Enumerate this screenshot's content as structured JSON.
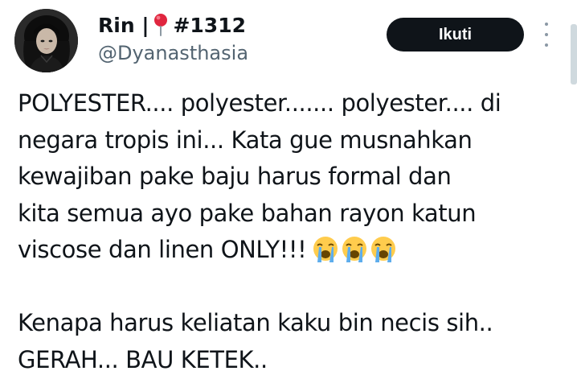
{
  "author": {
    "name": "Rin |",
    "tag": "#1312",
    "handle": "@Dyanasthasia",
    "pin_icon": "round-pushpin-icon"
  },
  "actions": {
    "follow_label": "Ikuti",
    "more_icon": "more-vertical-icon"
  },
  "tweet": {
    "paragraph1_lines": [
      "POLYESTER.... polyester....... polyester.... di",
      "negara tropis ini... Kata gue musnahkan",
      "kewajiban pake baju harus formal dan",
      "kita semua ayo pake bahan rayon katun",
      "viscose dan linen ONLY!!!"
    ],
    "emojis": [
      "loudly-crying-face",
      "loudly-crying-face",
      "loudly-crying-face"
    ],
    "paragraph2_lines": [
      "Kenapa harus keliatan kaku bin necis sih..",
      "GERAH... BAU KETEK.."
    ]
  },
  "colors": {
    "text": "#0f1419",
    "secondary_text": "#536471",
    "button_bg": "#0f1419",
    "button_text": "#ffffff"
  }
}
